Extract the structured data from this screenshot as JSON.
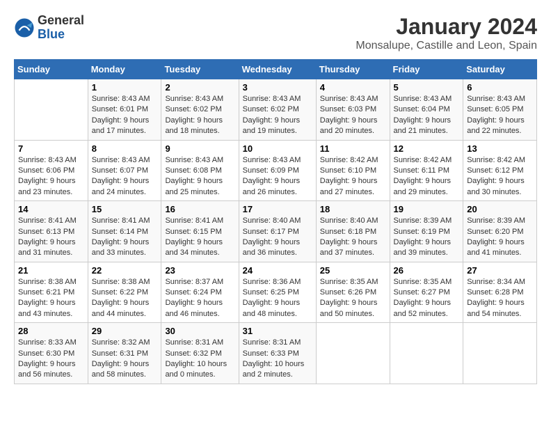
{
  "logo": {
    "general": "General",
    "blue": "Blue"
  },
  "title": "January 2024",
  "subtitle": "Monsalupe, Castille and Leon, Spain",
  "weekdays": [
    "Sunday",
    "Monday",
    "Tuesday",
    "Wednesday",
    "Thursday",
    "Friday",
    "Saturday"
  ],
  "weeks": [
    [
      {
        "day": "",
        "info": ""
      },
      {
        "day": "1",
        "info": "Sunrise: 8:43 AM\nSunset: 6:01 PM\nDaylight: 9 hours\nand 17 minutes."
      },
      {
        "day": "2",
        "info": "Sunrise: 8:43 AM\nSunset: 6:02 PM\nDaylight: 9 hours\nand 18 minutes."
      },
      {
        "day": "3",
        "info": "Sunrise: 8:43 AM\nSunset: 6:02 PM\nDaylight: 9 hours\nand 19 minutes."
      },
      {
        "day": "4",
        "info": "Sunrise: 8:43 AM\nSunset: 6:03 PM\nDaylight: 9 hours\nand 20 minutes."
      },
      {
        "day": "5",
        "info": "Sunrise: 8:43 AM\nSunset: 6:04 PM\nDaylight: 9 hours\nand 21 minutes."
      },
      {
        "day": "6",
        "info": "Sunrise: 8:43 AM\nSunset: 6:05 PM\nDaylight: 9 hours\nand 22 minutes."
      }
    ],
    [
      {
        "day": "7",
        "info": "Sunrise: 8:43 AM\nSunset: 6:06 PM\nDaylight: 9 hours\nand 23 minutes."
      },
      {
        "day": "8",
        "info": "Sunrise: 8:43 AM\nSunset: 6:07 PM\nDaylight: 9 hours\nand 24 minutes."
      },
      {
        "day": "9",
        "info": "Sunrise: 8:43 AM\nSunset: 6:08 PM\nDaylight: 9 hours\nand 25 minutes."
      },
      {
        "day": "10",
        "info": "Sunrise: 8:43 AM\nSunset: 6:09 PM\nDaylight: 9 hours\nand 26 minutes."
      },
      {
        "day": "11",
        "info": "Sunrise: 8:42 AM\nSunset: 6:10 PM\nDaylight: 9 hours\nand 27 minutes."
      },
      {
        "day": "12",
        "info": "Sunrise: 8:42 AM\nSunset: 6:11 PM\nDaylight: 9 hours\nand 29 minutes."
      },
      {
        "day": "13",
        "info": "Sunrise: 8:42 AM\nSunset: 6:12 PM\nDaylight: 9 hours\nand 30 minutes."
      }
    ],
    [
      {
        "day": "14",
        "info": "Sunrise: 8:41 AM\nSunset: 6:13 PM\nDaylight: 9 hours\nand 31 minutes."
      },
      {
        "day": "15",
        "info": "Sunrise: 8:41 AM\nSunset: 6:14 PM\nDaylight: 9 hours\nand 33 minutes."
      },
      {
        "day": "16",
        "info": "Sunrise: 8:41 AM\nSunset: 6:15 PM\nDaylight: 9 hours\nand 34 minutes."
      },
      {
        "day": "17",
        "info": "Sunrise: 8:40 AM\nSunset: 6:17 PM\nDaylight: 9 hours\nand 36 minutes."
      },
      {
        "day": "18",
        "info": "Sunrise: 8:40 AM\nSunset: 6:18 PM\nDaylight: 9 hours\nand 37 minutes."
      },
      {
        "day": "19",
        "info": "Sunrise: 8:39 AM\nSunset: 6:19 PM\nDaylight: 9 hours\nand 39 minutes."
      },
      {
        "day": "20",
        "info": "Sunrise: 8:39 AM\nSunset: 6:20 PM\nDaylight: 9 hours\nand 41 minutes."
      }
    ],
    [
      {
        "day": "21",
        "info": "Sunrise: 8:38 AM\nSunset: 6:21 PM\nDaylight: 9 hours\nand 43 minutes."
      },
      {
        "day": "22",
        "info": "Sunrise: 8:38 AM\nSunset: 6:22 PM\nDaylight: 9 hours\nand 44 minutes."
      },
      {
        "day": "23",
        "info": "Sunrise: 8:37 AM\nSunset: 6:24 PM\nDaylight: 9 hours\nand 46 minutes."
      },
      {
        "day": "24",
        "info": "Sunrise: 8:36 AM\nSunset: 6:25 PM\nDaylight: 9 hours\nand 48 minutes."
      },
      {
        "day": "25",
        "info": "Sunrise: 8:35 AM\nSunset: 6:26 PM\nDaylight: 9 hours\nand 50 minutes."
      },
      {
        "day": "26",
        "info": "Sunrise: 8:35 AM\nSunset: 6:27 PM\nDaylight: 9 hours\nand 52 minutes."
      },
      {
        "day": "27",
        "info": "Sunrise: 8:34 AM\nSunset: 6:28 PM\nDaylight: 9 hours\nand 54 minutes."
      }
    ],
    [
      {
        "day": "28",
        "info": "Sunrise: 8:33 AM\nSunset: 6:30 PM\nDaylight: 9 hours\nand 56 minutes."
      },
      {
        "day": "29",
        "info": "Sunrise: 8:32 AM\nSunset: 6:31 PM\nDaylight: 9 hours\nand 58 minutes."
      },
      {
        "day": "30",
        "info": "Sunrise: 8:31 AM\nSunset: 6:32 PM\nDaylight: 10 hours\nand 0 minutes."
      },
      {
        "day": "31",
        "info": "Sunrise: 8:31 AM\nSunset: 6:33 PM\nDaylight: 10 hours\nand 2 minutes."
      },
      {
        "day": "",
        "info": ""
      },
      {
        "day": "",
        "info": ""
      },
      {
        "day": "",
        "info": ""
      }
    ]
  ]
}
